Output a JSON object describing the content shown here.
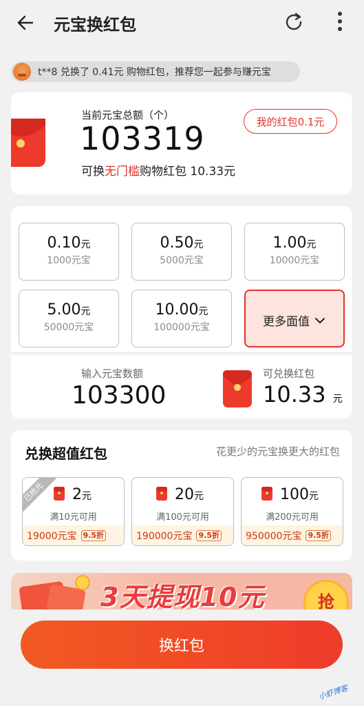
{
  "header": {
    "title": "元宝换红包",
    "back_icon": "arrow-left-icon",
    "refresh_icon": "refresh-icon",
    "more_icon": "more-vertical-icon"
  },
  "ticker": {
    "text": "t**8 兑换了 0.41元 购物红包，推荐您一起参与赚元宝"
  },
  "balance": {
    "label": "当前元宝总额（个）",
    "value": "103319",
    "convertible_prefix": "可换",
    "convertible_highlight": "无门槛",
    "convertible_suffix": "购物红包 10.33元",
    "my_packet_button": "我的红包0.1元"
  },
  "denominations": [
    {
      "amount": "0.10",
      "unit": "元",
      "cost": "1000元宝"
    },
    {
      "amount": "0.50",
      "unit": "元",
      "cost": "5000元宝"
    },
    {
      "amount": "1.00",
      "unit": "元",
      "cost": "10000元宝"
    },
    {
      "amount": "5.00",
      "unit": "元",
      "cost": "50000元宝"
    },
    {
      "amount": "10.00",
      "unit": "元",
      "cost": "100000元宝"
    }
  ],
  "more_denominations_label": "更多面值",
  "exchange_input": {
    "label": "输入元宝数额",
    "value": "103300",
    "result_label": "可兑换红包",
    "result_value": "10.33",
    "result_unit": "元"
  },
  "super_offers": {
    "title": "兑换超值红包",
    "subtitle": "花更少的元宝换更大的红包",
    "items": [
      {
        "value": "2",
        "unit": "元",
        "condition": "满10元可用",
        "price": "19000元宝",
        "discount": "9.5折",
        "tag": "已抢光"
      },
      {
        "value": "20",
        "unit": "元",
        "condition": "满100元可用",
        "price": "190000元宝",
        "discount": "9.5折"
      },
      {
        "value": "100",
        "unit": "元",
        "condition": "满200元可用",
        "price": "950000元宝",
        "discount": "9.5折"
      }
    ]
  },
  "banner": {
    "text": "3天提现10元",
    "button": "抢"
  },
  "cta": {
    "label": "换红包"
  },
  "watermark": "小虾博客",
  "colors": {
    "accent": "#e4322b",
    "cta_start": "#f25a22",
    "cta_end": "#ee3c2a",
    "background": "#f1f1f1"
  }
}
